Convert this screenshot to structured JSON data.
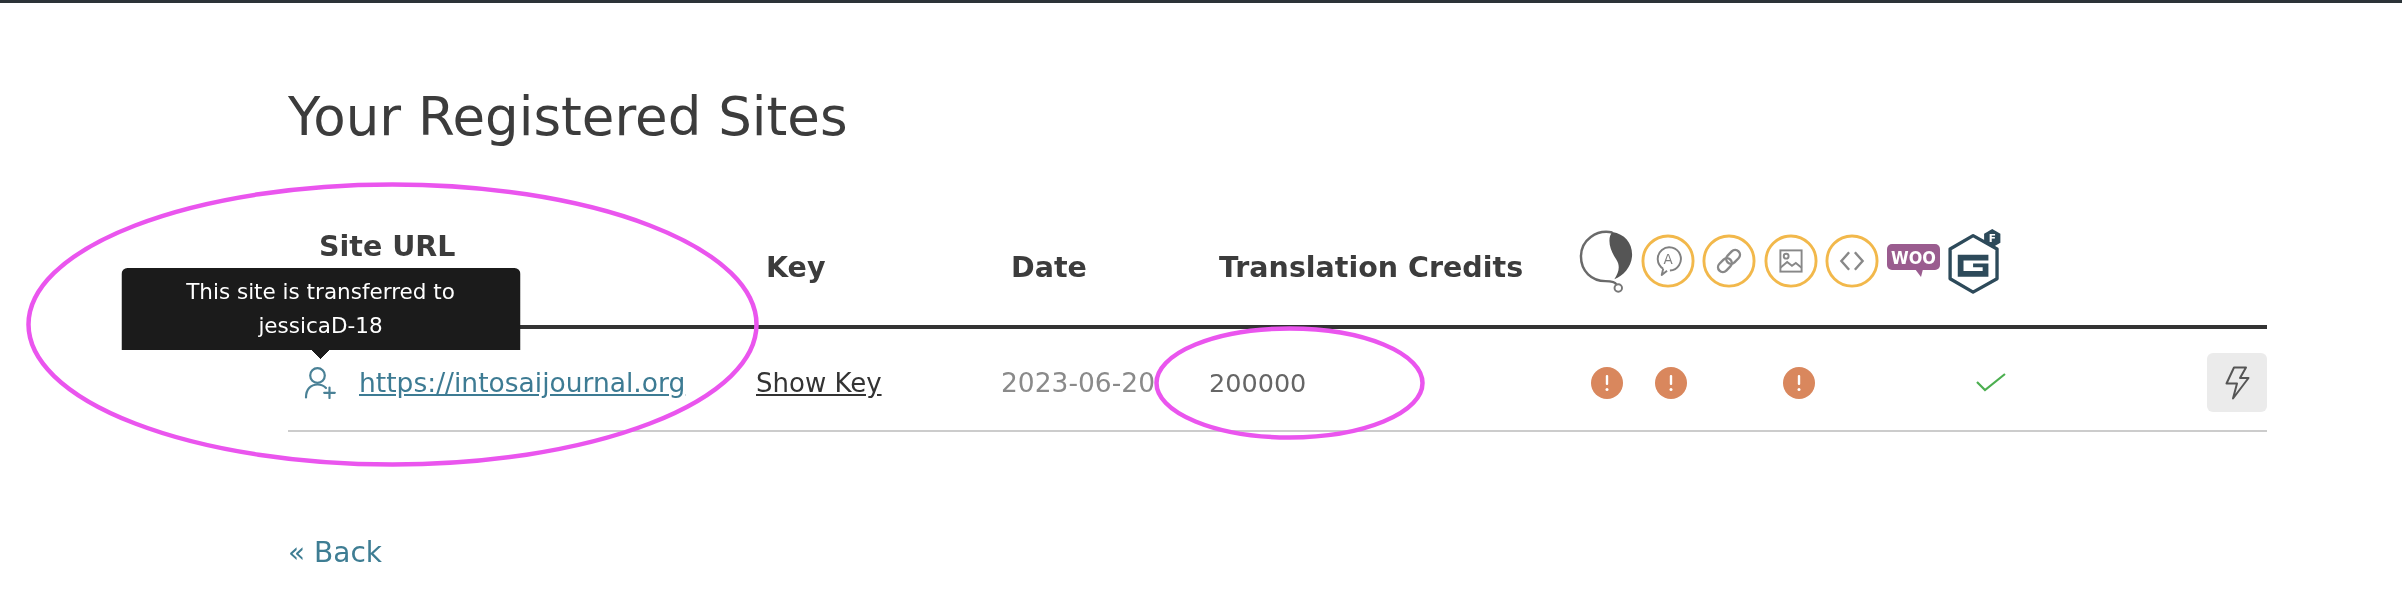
{
  "page": {
    "title": "Your Registered Sites"
  },
  "table": {
    "columns": [
      {
        "kind": "text",
        "label": "Site URL"
      },
      {
        "kind": "text",
        "label": "Key"
      },
      {
        "kind": "text",
        "label": "Date"
      },
      {
        "kind": "text",
        "label": "Translation Credits"
      },
      {
        "kind": "swirl"
      },
      {
        "kind": "bubble",
        "glyph": "A"
      },
      {
        "kind": "chain"
      },
      {
        "kind": "image"
      },
      {
        "kind": "code"
      },
      {
        "kind": "woo",
        "label": "WOO"
      },
      {
        "kind": "hexagon",
        "badge": "F"
      }
    ],
    "rows": [
      {
        "transferred": true,
        "tooltip": "This site is transferred to jessicaD-18",
        "site_url": "https://intosaijournal.org",
        "circled_site": true,
        "key_link": "Show Key",
        "date": "2023-06-20",
        "credits": "200000",
        "circled_credits": true,
        "statuses": [
          {
            "kind": "warning"
          },
          {
            "kind": "warning"
          },
          {
            "kind": "empty"
          },
          {
            "kind": "warning"
          },
          {
            "kind": "empty"
          },
          {
            "kind": "empty"
          },
          {
            "kind": "ok"
          }
        ]
      }
    ]
  },
  "back_link": "« Back"
}
